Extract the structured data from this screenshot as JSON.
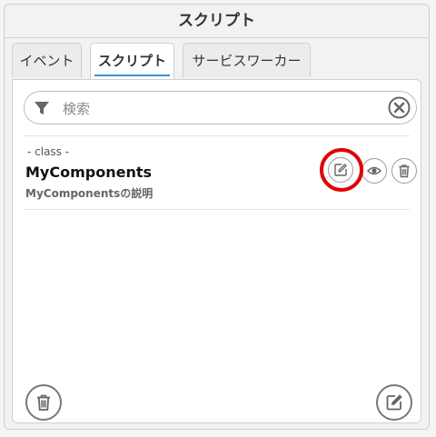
{
  "panel": {
    "title": "スクリプト"
  },
  "tabs": [
    {
      "label": "イベント",
      "active": false
    },
    {
      "label": "スクリプト",
      "active": true
    },
    {
      "label": "サービスワーカー",
      "active": false
    }
  ],
  "search": {
    "placeholder": "検索",
    "value": "",
    "filter_icon": "filter-icon",
    "clear_icon": "close-circle-icon"
  },
  "items": [
    {
      "type_label": "- class -",
      "name": "MyComponents",
      "description": "MyComponentsの説明",
      "actions": [
        "edit-icon",
        "eye-icon",
        "trash-icon"
      ]
    }
  ],
  "footer": {
    "left_icon": "trash-icon",
    "right_icon": "edit-icon"
  },
  "colors": {
    "accent": "#3a8fd6",
    "highlight": "#e00000",
    "icon": "#666666"
  }
}
